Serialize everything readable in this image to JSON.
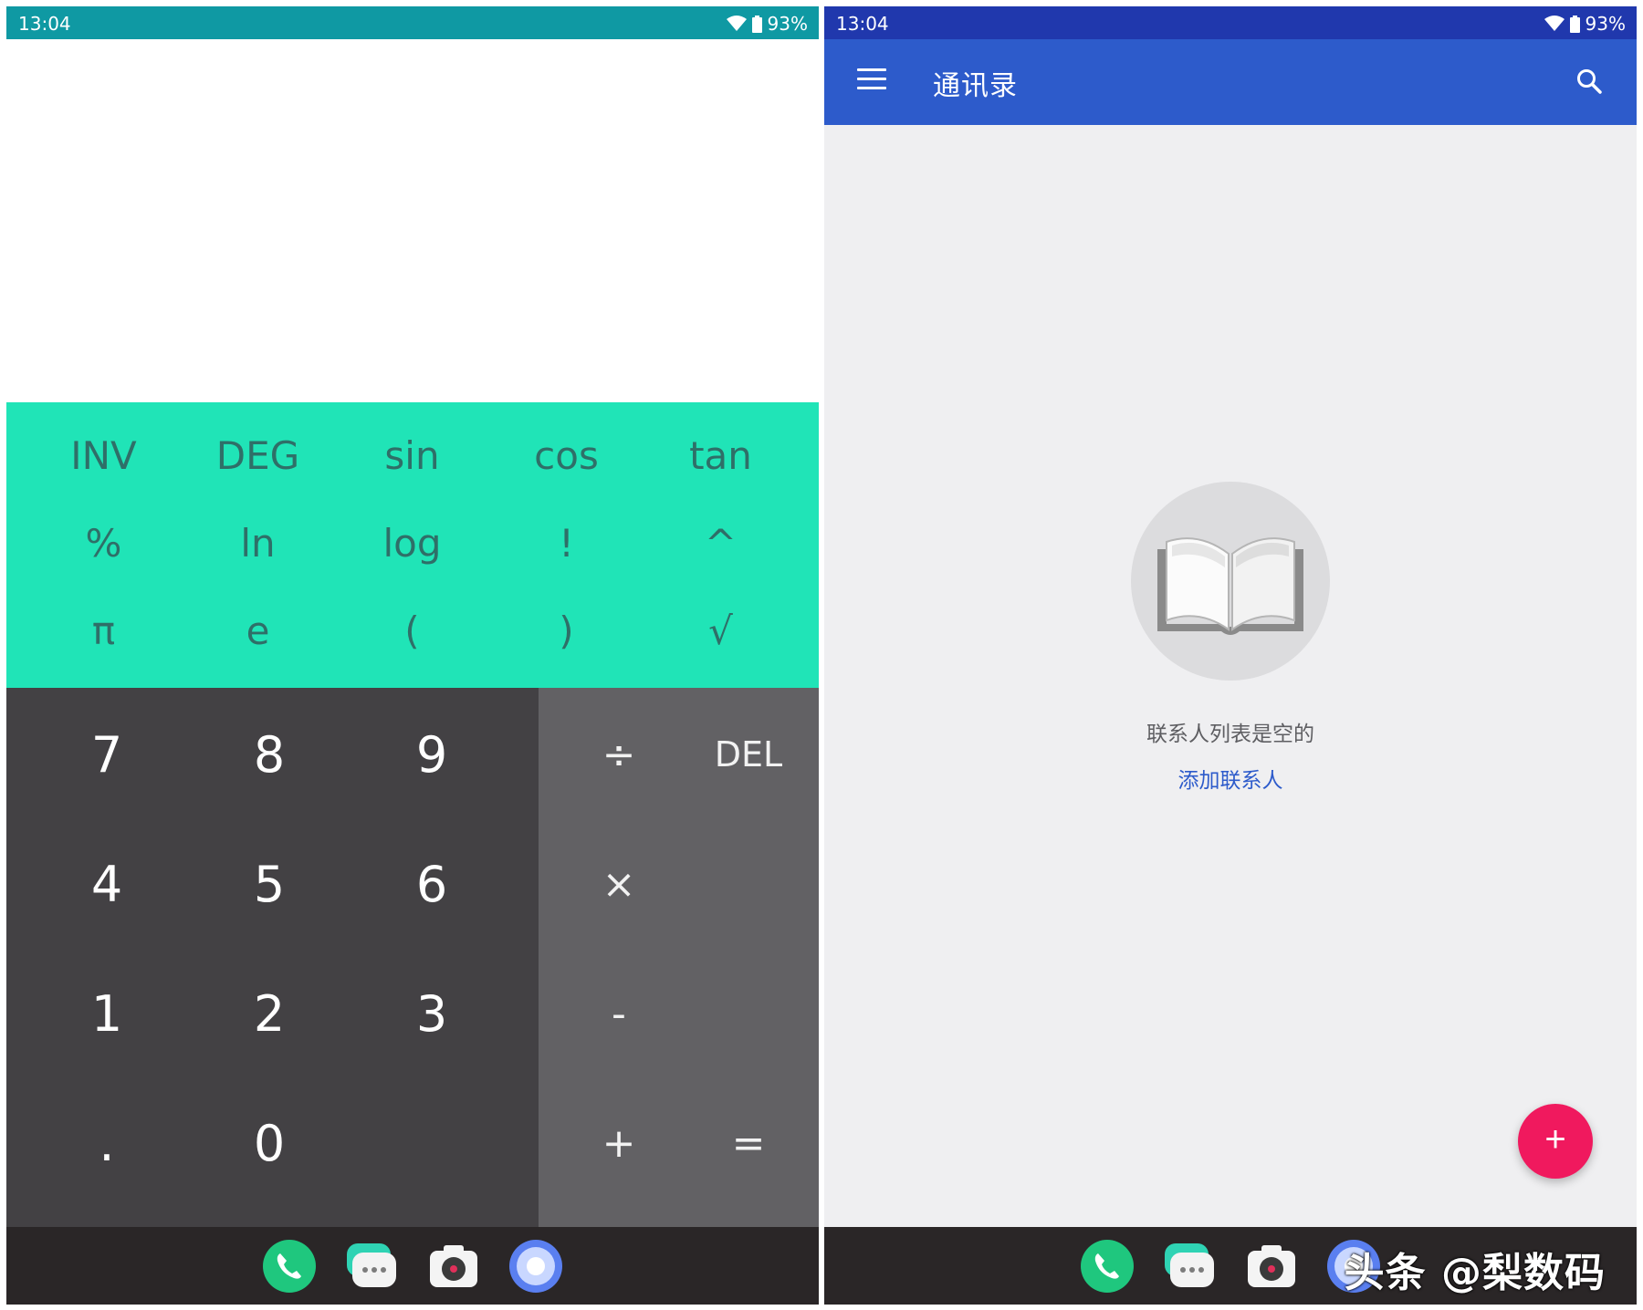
{
  "left_screen": {
    "status": {
      "time": "13:04",
      "battery": "93%"
    },
    "calculator": {
      "sci_rows": [
        [
          "INV",
          "DEG",
          "sin",
          "cos",
          "tan"
        ],
        [
          "%",
          "ln",
          "log",
          "!",
          "^"
        ],
        [
          "π",
          "e",
          "(",
          ")",
          "√"
        ]
      ],
      "num_rows": [
        [
          "7",
          "8",
          "9"
        ],
        [
          "4",
          "5",
          "6"
        ],
        [
          "1",
          "2",
          "3"
        ],
        [
          ".",
          "0",
          ""
        ]
      ],
      "op_keys": {
        "divide": "÷",
        "del": "DEL",
        "multiply": "×",
        "minus": "-",
        "plus": "+",
        "equals": "="
      }
    }
  },
  "right_screen": {
    "status": {
      "time": "13:04",
      "battery": "93%"
    },
    "appbar": {
      "title": "通讯录"
    },
    "empty_state": {
      "message": "联系人列表是空的",
      "action": "添加联系人"
    },
    "fab": {
      "label": "+"
    },
    "watermark": "头条 @梨数码"
  },
  "dock": {
    "apps": [
      "phone-app-icon",
      "messages-app-icon",
      "camera-app-icon",
      "browser-app-icon"
    ]
  },
  "colors": {
    "calc_status_bar": "#0f99a3",
    "calc_sci_panel": "#20e4b7",
    "calc_numpad": "#434144",
    "calc_oppad": "#626164",
    "contacts_status_bar": "#2038ad",
    "contacts_appbar": "#2d5bcb",
    "fab": "#f0195e"
  }
}
